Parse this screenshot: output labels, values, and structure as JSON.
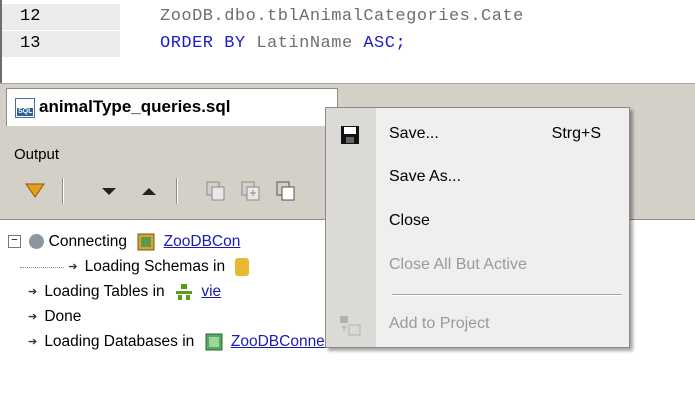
{
  "editor": {
    "lines": [
      {
        "num": "12",
        "code_text": "ZooDB.dbo.tblAnimalCategories.Cate",
        "keyword": ""
      },
      {
        "num": "13",
        "keyword": "ORDER BY",
        "code_text": "LatinName",
        "keyword2": "ASC;"
      }
    ]
  },
  "tab": {
    "label": "animalType_queries.sql",
    "icon": "sql-file-icon"
  },
  "output": {
    "title": "Output",
    "toolbar_icons": [
      "filter-icon",
      "next-down-icon",
      "previous-up-icon",
      "copy-icon",
      "copy-all-icon",
      "copy-to-clipboard-icon"
    ],
    "log": [
      {
        "text": "Connecting",
        "link": "ZooDBCon"
      },
      {
        "text": "Loading Schemas  in",
        "link": ""
      },
      {
        "text": "Loading Tables  in",
        "link": "vie"
      },
      {
        "text": "Done",
        "link": ""
      },
      {
        "text": "Loading Databases  in",
        "link": "ZooDBConnect"
      }
    ]
  },
  "context_menu": {
    "items": [
      {
        "label": "Save...",
        "shortcut": "Strg+S",
        "enabled": true,
        "icon": "save-icon"
      },
      {
        "label": "Save As...",
        "shortcut": "",
        "enabled": true
      },
      {
        "label": "Close",
        "shortcut": "",
        "enabled": true
      },
      {
        "label": "Close All But Active",
        "shortcut": "",
        "enabled": false
      },
      {
        "label": "Add to Project",
        "shortcut": "",
        "enabled": false,
        "icon": "add-to-project-icon"
      }
    ]
  },
  "colors": {
    "keyword": "#1c1cc8",
    "link": "#1a1ab5",
    "panel": "#d4d0c8",
    "disabled": "#9a9a9a"
  }
}
